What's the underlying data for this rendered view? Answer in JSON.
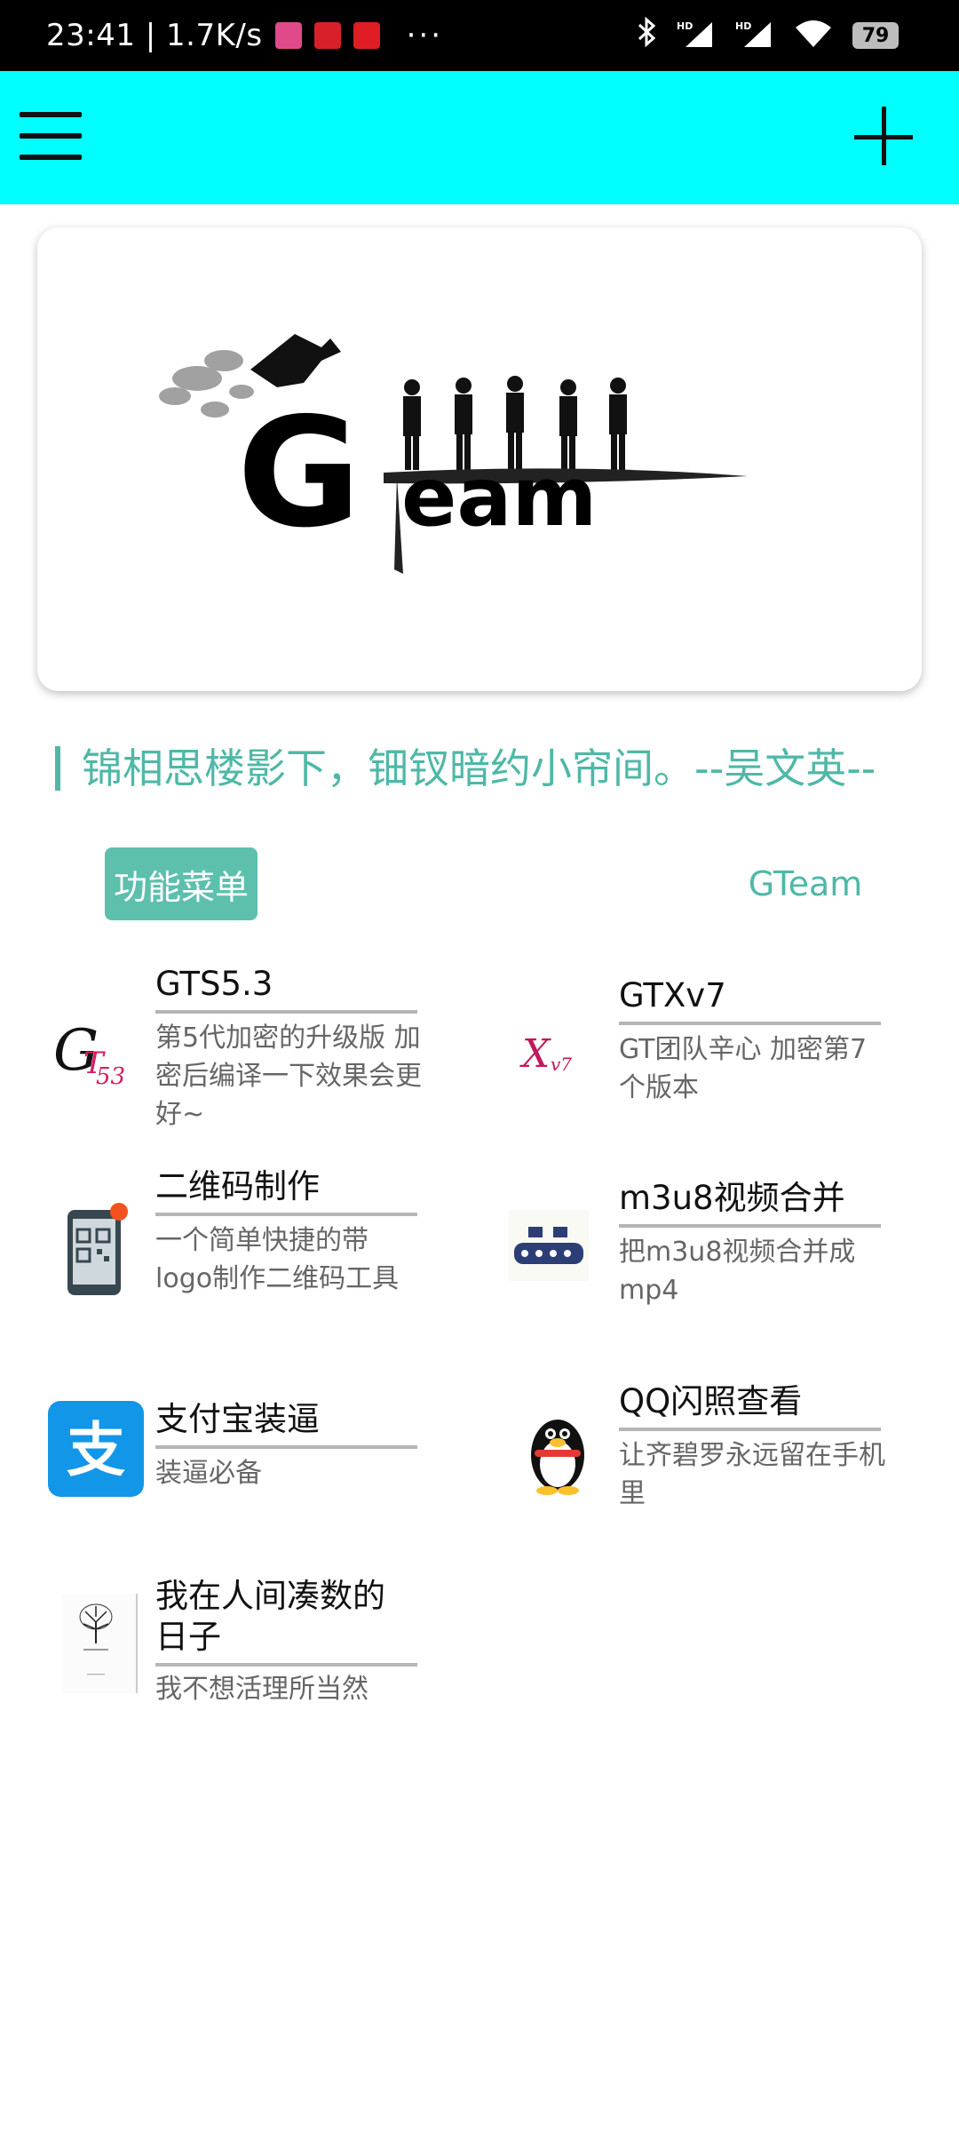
{
  "status_bar": {
    "time_speed": "23:41 | 1.7K/s",
    "more": "···",
    "battery": "79",
    "icons": [
      "bluetooth-icon",
      "hd-signal-icon",
      "hd-signal-icon",
      "wifi-icon"
    ]
  },
  "toolbar": {
    "menu_icon": "hamburger-menu-icon",
    "add_icon": "plus-icon",
    "color": "#00ffff"
  },
  "banner": {
    "logo_text": "GTeam"
  },
  "quote": {
    "text": "锦相思楼影下，钿钗暗约小帘间。--吴文英--"
  },
  "tabs": [
    {
      "label": "功能菜单",
      "active": true
    },
    {
      "label": "GTeam",
      "active": false
    }
  ],
  "accent_color": "#4fb8a7",
  "tools": [
    {
      "title": "GTS5.3",
      "desc": "第5代加密的升级版 加密后编译一下效果会更好~",
      "icon": "gts-logo-icon"
    },
    {
      "title": "GTXv7",
      "desc": "GT团队辛心 加密第7个版本",
      "icon": "gtx-logo-icon"
    },
    {
      "title": "二维码制作",
      "desc": "一个简单快捷的带logo制作二维码工具",
      "icon": "qr-phone-icon"
    },
    {
      "title": "m3u8视频合并",
      "desc": "把m3u8视频合并成mp4",
      "icon": "video-merge-icon"
    },
    {
      "title": "支付宝装逼",
      "desc": "装逼必备",
      "icon": "alipay-icon"
    },
    {
      "title": "QQ闪照查看",
      "desc": "让齐碧罗永远留在手机里",
      "icon": "qq-penguin-icon"
    },
    {
      "title": "我在人间凑数的日子",
      "desc": "我不想活理所当然",
      "icon": "tree-book-icon"
    }
  ]
}
